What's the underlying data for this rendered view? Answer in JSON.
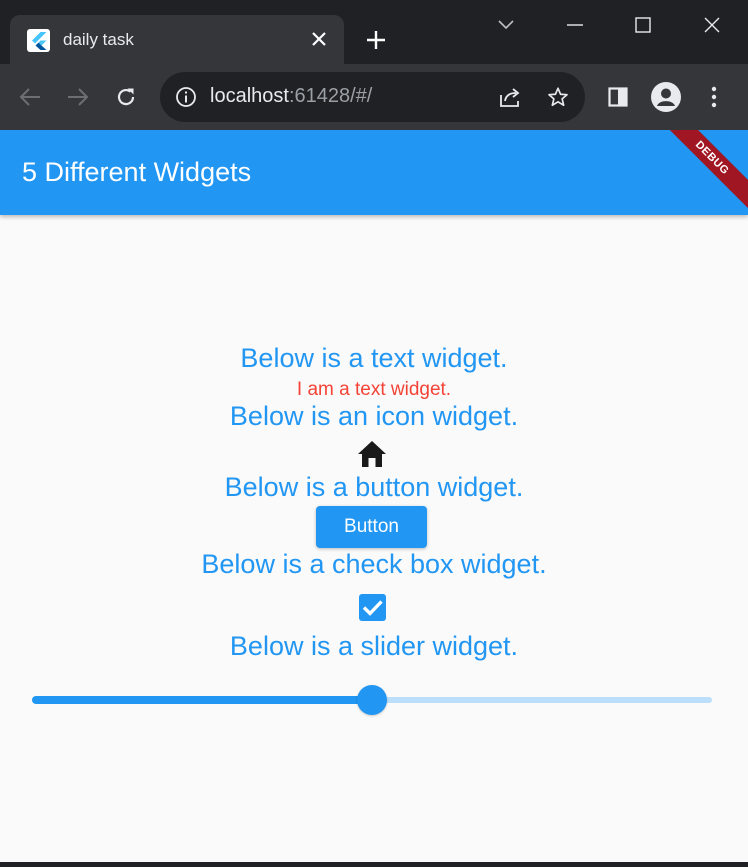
{
  "browser": {
    "tab_title": "daily task",
    "url_host": "localhost",
    "url_path": ":61428/#/"
  },
  "app": {
    "title": "5 Different Widgets",
    "debug_label": "DEBUG",
    "text_heading": "Below is a text widget.",
    "text_widget": "I am a text widget.",
    "icon_heading": "Below is an icon widget.",
    "icon_name": "home-icon",
    "button_heading": "Below is a button widget.",
    "button_label": "Button",
    "checkbox_heading": "Below is a check box widget.",
    "checkbox_checked": true,
    "slider_heading": "Below is a slider widget.",
    "slider_value": 0.5
  },
  "colors": {
    "primary": "#2196f3",
    "text_widget": "#f44336",
    "debug_banner": "#a01622"
  }
}
